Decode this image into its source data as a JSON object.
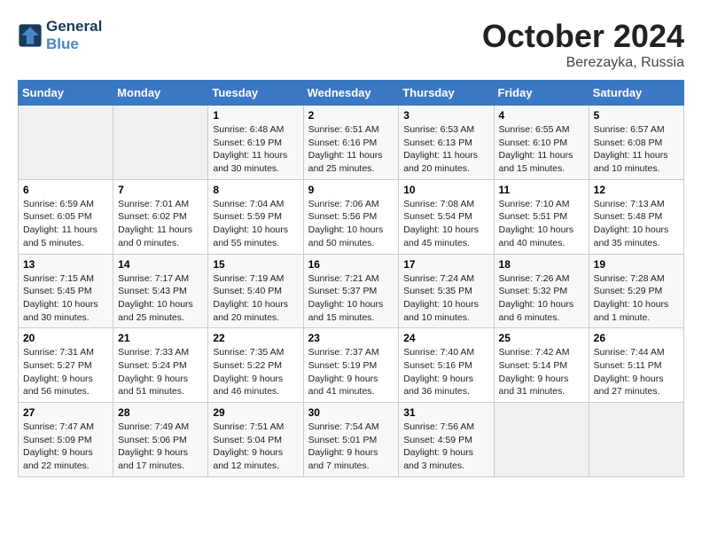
{
  "logo": {
    "line1": "General",
    "line2": "Blue"
  },
  "title": "October 2024",
  "location": "Berezayka, Russia",
  "days_header": [
    "Sunday",
    "Monday",
    "Tuesday",
    "Wednesday",
    "Thursday",
    "Friday",
    "Saturday"
  ],
  "weeks": [
    [
      {
        "num": "",
        "info": ""
      },
      {
        "num": "",
        "info": ""
      },
      {
        "num": "1",
        "info": "Sunrise: 6:48 AM\nSunset: 6:19 PM\nDaylight: 11 hours and 30 minutes."
      },
      {
        "num": "2",
        "info": "Sunrise: 6:51 AM\nSunset: 6:16 PM\nDaylight: 11 hours and 25 minutes."
      },
      {
        "num": "3",
        "info": "Sunrise: 6:53 AM\nSunset: 6:13 PM\nDaylight: 11 hours and 20 minutes."
      },
      {
        "num": "4",
        "info": "Sunrise: 6:55 AM\nSunset: 6:10 PM\nDaylight: 11 hours and 15 minutes."
      },
      {
        "num": "5",
        "info": "Sunrise: 6:57 AM\nSunset: 6:08 PM\nDaylight: 11 hours and 10 minutes."
      }
    ],
    [
      {
        "num": "6",
        "info": "Sunrise: 6:59 AM\nSunset: 6:05 PM\nDaylight: 11 hours and 5 minutes."
      },
      {
        "num": "7",
        "info": "Sunrise: 7:01 AM\nSunset: 6:02 PM\nDaylight: 11 hours and 0 minutes."
      },
      {
        "num": "8",
        "info": "Sunrise: 7:04 AM\nSunset: 5:59 PM\nDaylight: 10 hours and 55 minutes."
      },
      {
        "num": "9",
        "info": "Sunrise: 7:06 AM\nSunset: 5:56 PM\nDaylight: 10 hours and 50 minutes."
      },
      {
        "num": "10",
        "info": "Sunrise: 7:08 AM\nSunset: 5:54 PM\nDaylight: 10 hours and 45 minutes."
      },
      {
        "num": "11",
        "info": "Sunrise: 7:10 AM\nSunset: 5:51 PM\nDaylight: 10 hours and 40 minutes."
      },
      {
        "num": "12",
        "info": "Sunrise: 7:13 AM\nSunset: 5:48 PM\nDaylight: 10 hours and 35 minutes."
      }
    ],
    [
      {
        "num": "13",
        "info": "Sunrise: 7:15 AM\nSunset: 5:45 PM\nDaylight: 10 hours and 30 minutes."
      },
      {
        "num": "14",
        "info": "Sunrise: 7:17 AM\nSunset: 5:43 PM\nDaylight: 10 hours and 25 minutes."
      },
      {
        "num": "15",
        "info": "Sunrise: 7:19 AM\nSunset: 5:40 PM\nDaylight: 10 hours and 20 minutes."
      },
      {
        "num": "16",
        "info": "Sunrise: 7:21 AM\nSunset: 5:37 PM\nDaylight: 10 hours and 15 minutes."
      },
      {
        "num": "17",
        "info": "Sunrise: 7:24 AM\nSunset: 5:35 PM\nDaylight: 10 hours and 10 minutes."
      },
      {
        "num": "18",
        "info": "Sunrise: 7:26 AM\nSunset: 5:32 PM\nDaylight: 10 hours and 6 minutes."
      },
      {
        "num": "19",
        "info": "Sunrise: 7:28 AM\nSunset: 5:29 PM\nDaylight: 10 hours and 1 minute."
      }
    ],
    [
      {
        "num": "20",
        "info": "Sunrise: 7:31 AM\nSunset: 5:27 PM\nDaylight: 9 hours and 56 minutes."
      },
      {
        "num": "21",
        "info": "Sunrise: 7:33 AM\nSunset: 5:24 PM\nDaylight: 9 hours and 51 minutes."
      },
      {
        "num": "22",
        "info": "Sunrise: 7:35 AM\nSunset: 5:22 PM\nDaylight: 9 hours and 46 minutes."
      },
      {
        "num": "23",
        "info": "Sunrise: 7:37 AM\nSunset: 5:19 PM\nDaylight: 9 hours and 41 minutes."
      },
      {
        "num": "24",
        "info": "Sunrise: 7:40 AM\nSunset: 5:16 PM\nDaylight: 9 hours and 36 minutes."
      },
      {
        "num": "25",
        "info": "Sunrise: 7:42 AM\nSunset: 5:14 PM\nDaylight: 9 hours and 31 minutes."
      },
      {
        "num": "26",
        "info": "Sunrise: 7:44 AM\nSunset: 5:11 PM\nDaylight: 9 hours and 27 minutes."
      }
    ],
    [
      {
        "num": "27",
        "info": "Sunrise: 7:47 AM\nSunset: 5:09 PM\nDaylight: 9 hours and 22 minutes."
      },
      {
        "num": "28",
        "info": "Sunrise: 7:49 AM\nSunset: 5:06 PM\nDaylight: 9 hours and 17 minutes."
      },
      {
        "num": "29",
        "info": "Sunrise: 7:51 AM\nSunset: 5:04 PM\nDaylight: 9 hours and 12 minutes."
      },
      {
        "num": "30",
        "info": "Sunrise: 7:54 AM\nSunset: 5:01 PM\nDaylight: 9 hours and 7 minutes."
      },
      {
        "num": "31",
        "info": "Sunrise: 7:56 AM\nSunset: 4:59 PM\nDaylight: 9 hours and 3 minutes."
      },
      {
        "num": "",
        "info": ""
      },
      {
        "num": "",
        "info": ""
      }
    ]
  ]
}
